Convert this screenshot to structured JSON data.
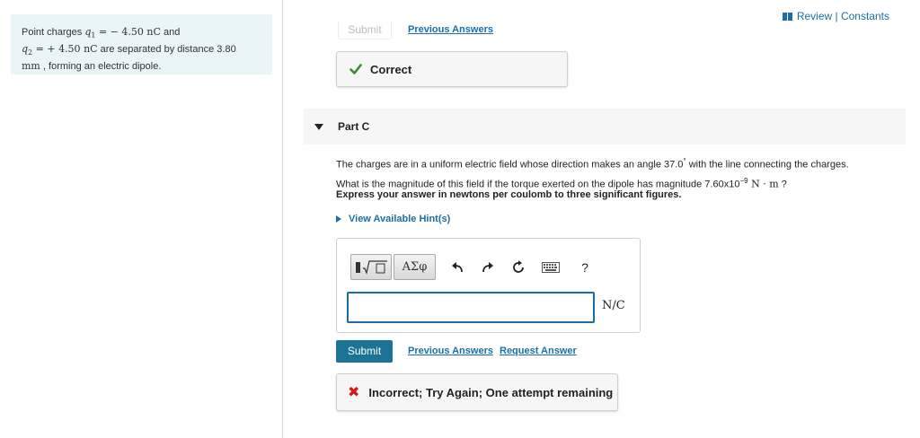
{
  "problem": {
    "line1_pre": "Point charges ",
    "q1_var": "q",
    "q1_sub": "1",
    "q1_eq": " = − 4.50 ",
    "q1_unit": "nC",
    "line1_post": " and",
    "q2_var": "q",
    "q2_sub": "2",
    "q2_eq": " = + 4.50 ",
    "q2_unit": "nC",
    "line2_post": " are separated by distance 3.80",
    "dist_unit": "mm",
    "line3_post": " , forming an electric dipole."
  },
  "header": {
    "review_constants": "Review | Constants"
  },
  "previous_part": {
    "submit_label": "Submit",
    "previous_answers": "Previous Answers",
    "correct_text": "Correct"
  },
  "part_c": {
    "title": "Part C",
    "q_line1": "The charges are in a uniform electric field whose direction makes an angle 37.0",
    "q_degree": "°",
    "q_line1_end": " with the line connecting the charges.",
    "q_line2_pre": "What is the magnitude of this field if the torque exerted on the dipole has magnitude 7.60x10",
    "q_exp": "−9",
    "q_unit": " N · m",
    "q_line2_end": " ?",
    "instructions": "Express your answer in newtons per coulomb to three significant figures.",
    "hints": "View Available Hint(s)"
  },
  "toolbar": {
    "templates_label": "▮√▢",
    "symbols_label": "ΑΣφ",
    "undo_icon": "undo-icon",
    "redo_icon": "redo-icon",
    "reset_icon": "reset-icon",
    "keyboard_icon": "keyboard-icon",
    "help_label": "?"
  },
  "answer": {
    "value": "",
    "unit": "N/C"
  },
  "actions": {
    "submit_label": "Submit",
    "previous_answers": "Previous Answers",
    "request_answer": "Request Answer"
  },
  "feedback": {
    "incorrect_text": "Incorrect; Try Again; One attempt remaining"
  },
  "colors": {
    "link": "#1a6fa6",
    "submit_bg": "#1d7395",
    "correct": "#3a8d2e",
    "incorrect": "#d11a1a",
    "panel_bg": "#e9f5f7"
  }
}
